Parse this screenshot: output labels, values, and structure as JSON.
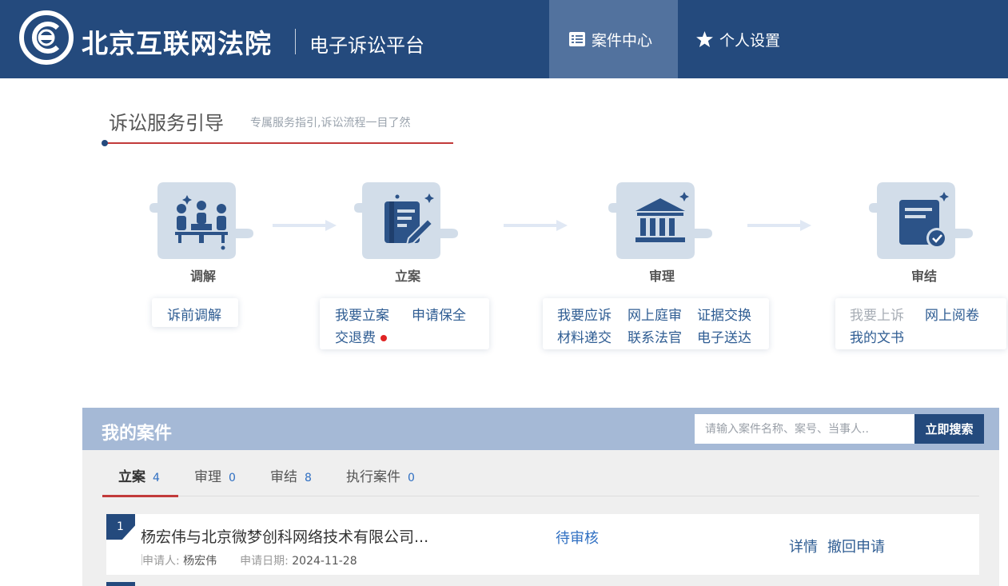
{
  "header": {
    "court_name": "北京互联网法院",
    "platform_name": "电子诉讼平台",
    "nav": [
      {
        "label": "案件中心",
        "icon": "list-icon",
        "active": true
      },
      {
        "label": "个人设置",
        "icon": "star-icon",
        "active": false
      }
    ]
  },
  "guide": {
    "title": "诉讼服务引导",
    "subtitle": "专属服务指引,诉讼流程一目了然",
    "steps": [
      {
        "label": "调解",
        "icon": "meeting-icon",
        "links": [
          {
            "label": "诉前调解",
            "enabled": true
          }
        ]
      },
      {
        "label": "立案",
        "icon": "document-edit-icon",
        "links": [
          {
            "label": "我要立案",
            "enabled": true
          },
          {
            "label": "申请保全",
            "enabled": true
          },
          {
            "label": "交退费",
            "enabled": true,
            "badge": "red-dot"
          }
        ]
      },
      {
        "label": "审理",
        "icon": "courthouse-icon",
        "links": [
          {
            "label": "我要应诉",
            "enabled": true
          },
          {
            "label": "网上庭审",
            "enabled": true
          },
          {
            "label": "证据交换",
            "enabled": true
          },
          {
            "label": "材料递交",
            "enabled": true
          },
          {
            "label": "联系法官",
            "enabled": true
          },
          {
            "label": "电子送达",
            "enabled": true
          }
        ]
      },
      {
        "label": "审结",
        "icon": "verdict-icon",
        "links": [
          {
            "label": "我要上诉",
            "enabled": false
          },
          {
            "label": "网上阅卷",
            "enabled": true
          },
          {
            "label": "我的文书",
            "enabled": true
          }
        ]
      }
    ]
  },
  "my_cases": {
    "title": "我的案件",
    "search": {
      "placeholder": "请输入案件名称、案号、当事人..",
      "button": "立即搜索"
    },
    "tabs": [
      {
        "label": "立案",
        "count": "4",
        "active": true
      },
      {
        "label": "审理",
        "count": "0",
        "active": false
      },
      {
        "label": "审结",
        "count": "8",
        "active": false
      },
      {
        "label": "执行案件",
        "count": "0",
        "active": false
      }
    ],
    "cases": [
      {
        "index": "1",
        "title": "杨宏伟与北京微梦创科网络技术有限公司...",
        "status": "待审核",
        "applicant_label": "申请人:",
        "applicant": "杨宏伟",
        "date_label": "申请日期:",
        "date": "2024-11-28",
        "actions": [
          "详情",
          "撤回申请"
        ]
      }
    ]
  },
  "colors": {
    "header_bg": "#244a7d",
    "nav_active_bg": "#52729e",
    "accent_red": "#c23a3a",
    "link_blue": "#2f5d93"
  }
}
